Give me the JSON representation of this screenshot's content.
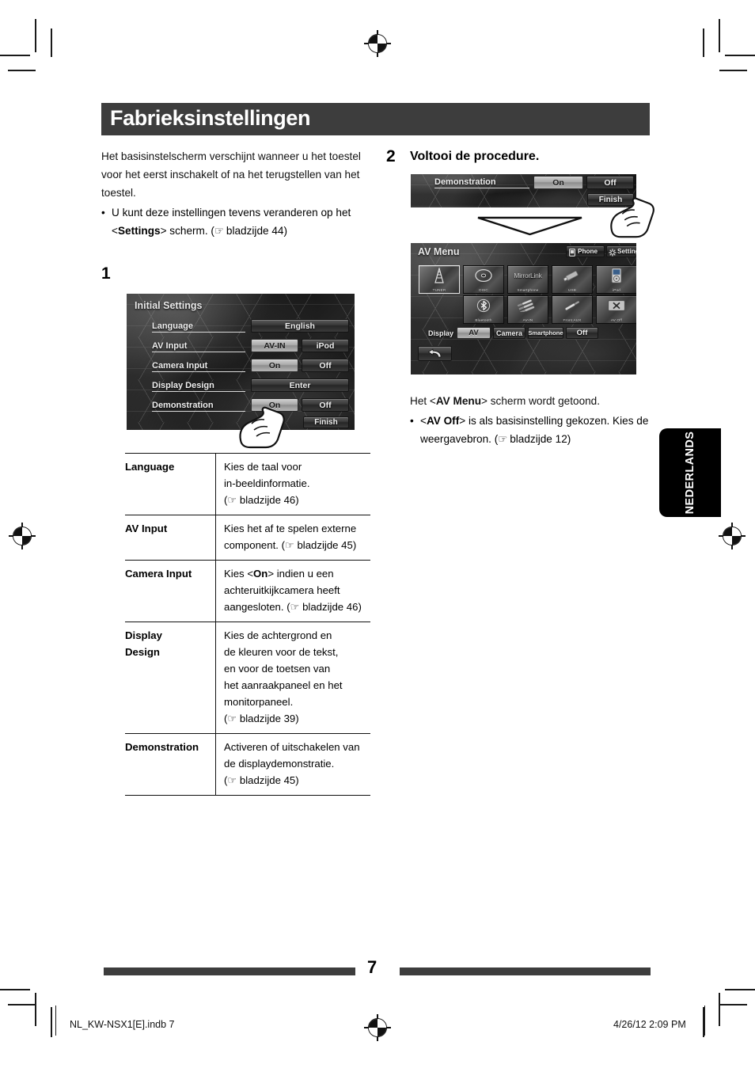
{
  "header": {
    "title": "Fabrieksinstellingen"
  },
  "intro": {
    "paragraph": "Het basisinstelscherm verschijnt wanneer u het toestel voor het eerst inschakelt of na het terugstellen van het toestel.",
    "bullet_prefix": "U kunt deze instellingen tevens veranderen op het <",
    "bullet_bold": "Settings",
    "bullet_suffix": "> scherm. (",
    "bullet_page": " bladzijde 44)",
    "bullet_mark": "☞"
  },
  "steps": [
    {
      "number": "1",
      "heading": ""
    },
    {
      "number": "2",
      "heading": "Voltooi de procedure."
    }
  ],
  "initial_settings_screen": {
    "title": "Initial Settings",
    "rows": [
      {
        "label": "Language",
        "buttons": [
          {
            "text": "English",
            "selected": false,
            "wide": true
          }
        ]
      },
      {
        "label": "AV Input",
        "buttons": [
          {
            "text": "AV-IN",
            "selected": true
          },
          {
            "text": "iPod",
            "selected": false
          }
        ]
      },
      {
        "label": "Camera Input",
        "buttons": [
          {
            "text": "On",
            "selected": true
          },
          {
            "text": "Off",
            "selected": false
          }
        ]
      },
      {
        "label": "Display Design",
        "buttons": [
          {
            "text": "Enter",
            "selected": false,
            "wide": true
          }
        ]
      },
      {
        "label": "Demonstration",
        "buttons": [
          {
            "text": "On",
            "selected": true
          },
          {
            "text": "Off",
            "selected": false
          }
        ]
      }
    ],
    "finish_label": "Finish"
  },
  "demo_strip_screen": {
    "label": "Demonstration",
    "on_label": "On",
    "off_label": "Off",
    "finish_label": "Finish"
  },
  "av_menu_screen": {
    "title": "AV Menu",
    "phone_label": "Phone",
    "settings_label": "Settings",
    "sources_row1": [
      {
        "label": "TUNER",
        "icon": "antenna-icon",
        "selected": true
      },
      {
        "label": "DISC",
        "icon": "disc-icon",
        "selected": false
      },
      {
        "label": "Smartphone",
        "icon": "mirrorlink-icon",
        "selected": false,
        "icon_text": "MirrorLink"
      },
      {
        "label": "USB",
        "icon": "usb-stick-icon",
        "selected": false
      },
      {
        "label": "iPod",
        "icon": "ipod-icon",
        "selected": false
      }
    ],
    "sources_row2": [
      {
        "label": "Bluetooth",
        "icon": "bluetooth-icon",
        "selected": false
      },
      {
        "label": "AV-IN",
        "icon": "rca-cables-icon",
        "selected": false
      },
      {
        "label": "Front AUX",
        "icon": "aux-plug-icon",
        "selected": false
      },
      {
        "label": "AV Off",
        "icon": "close-x-icon",
        "selected": false
      }
    ],
    "display_label": "Display",
    "display_buttons": [
      {
        "text": "AV",
        "selected": true
      },
      {
        "text": "Camera",
        "selected": false
      },
      {
        "text": "Smartphone",
        "selected": false
      },
      {
        "text": "Off",
        "selected": false
      }
    ],
    "back_icon": "back-arrow-icon"
  },
  "result_text": {
    "line1_prefix": "Het <",
    "line1_bold": "AV Menu",
    "line1_suffix": "> scherm wordt getoond.",
    "bullet_prefix": "<",
    "bullet_bold": "AV Off",
    "bullet_suffix": "> is als basisinstelling gekozen. Kies de weergavebron. (",
    "bullet_page": " bladzijde 12)",
    "bullet_mark": "☞"
  },
  "table": {
    "rows": [
      {
        "key": "Language",
        "lines": [
          "Kies de taal voor",
          "in-beeldinformatie.",
          "(☞ bladzijde 46)"
        ]
      },
      {
        "key": "AV Input",
        "lines": [
          "Kies het af te spelen externe",
          "component. (☞ bladzijde 45)"
        ]
      },
      {
        "key": "Camera Input",
        "lines": [
          "Kies <On> indien u een",
          "achteruitkijkcamera heeft",
          "aangesloten. (☞ bladzijde 46)"
        ],
        "bold_token": "On"
      },
      {
        "key": "Display Design",
        "key_lines": [
          "Display",
          "Design"
        ],
        "lines": [
          "Kies de achtergrond en",
          "de kleuren voor de tekst,",
          "en voor de toetsen van",
          "het aanraakpaneel en het",
          "monitorpaneel.",
          "(☞ bladzijde 39)"
        ]
      },
      {
        "key": "Demonstration",
        "lines": [
          "Activeren of uitschakelen van",
          "de displaydemonstratie.",
          "(☞ bladzijde 45)"
        ]
      }
    ]
  },
  "side_tab": {
    "label": "NEDERLANDS"
  },
  "footer": {
    "page_number": "7",
    "file_name": "NL_KW-NSX1[E].indb   7",
    "timestamp": "4/26/12   2:09 PM"
  },
  "colors": {
    "header_bar": "#3d3d3d",
    "rule": "#111111",
    "side_tab_bg": "#000000",
    "selected_button": "#b6b6b6"
  }
}
